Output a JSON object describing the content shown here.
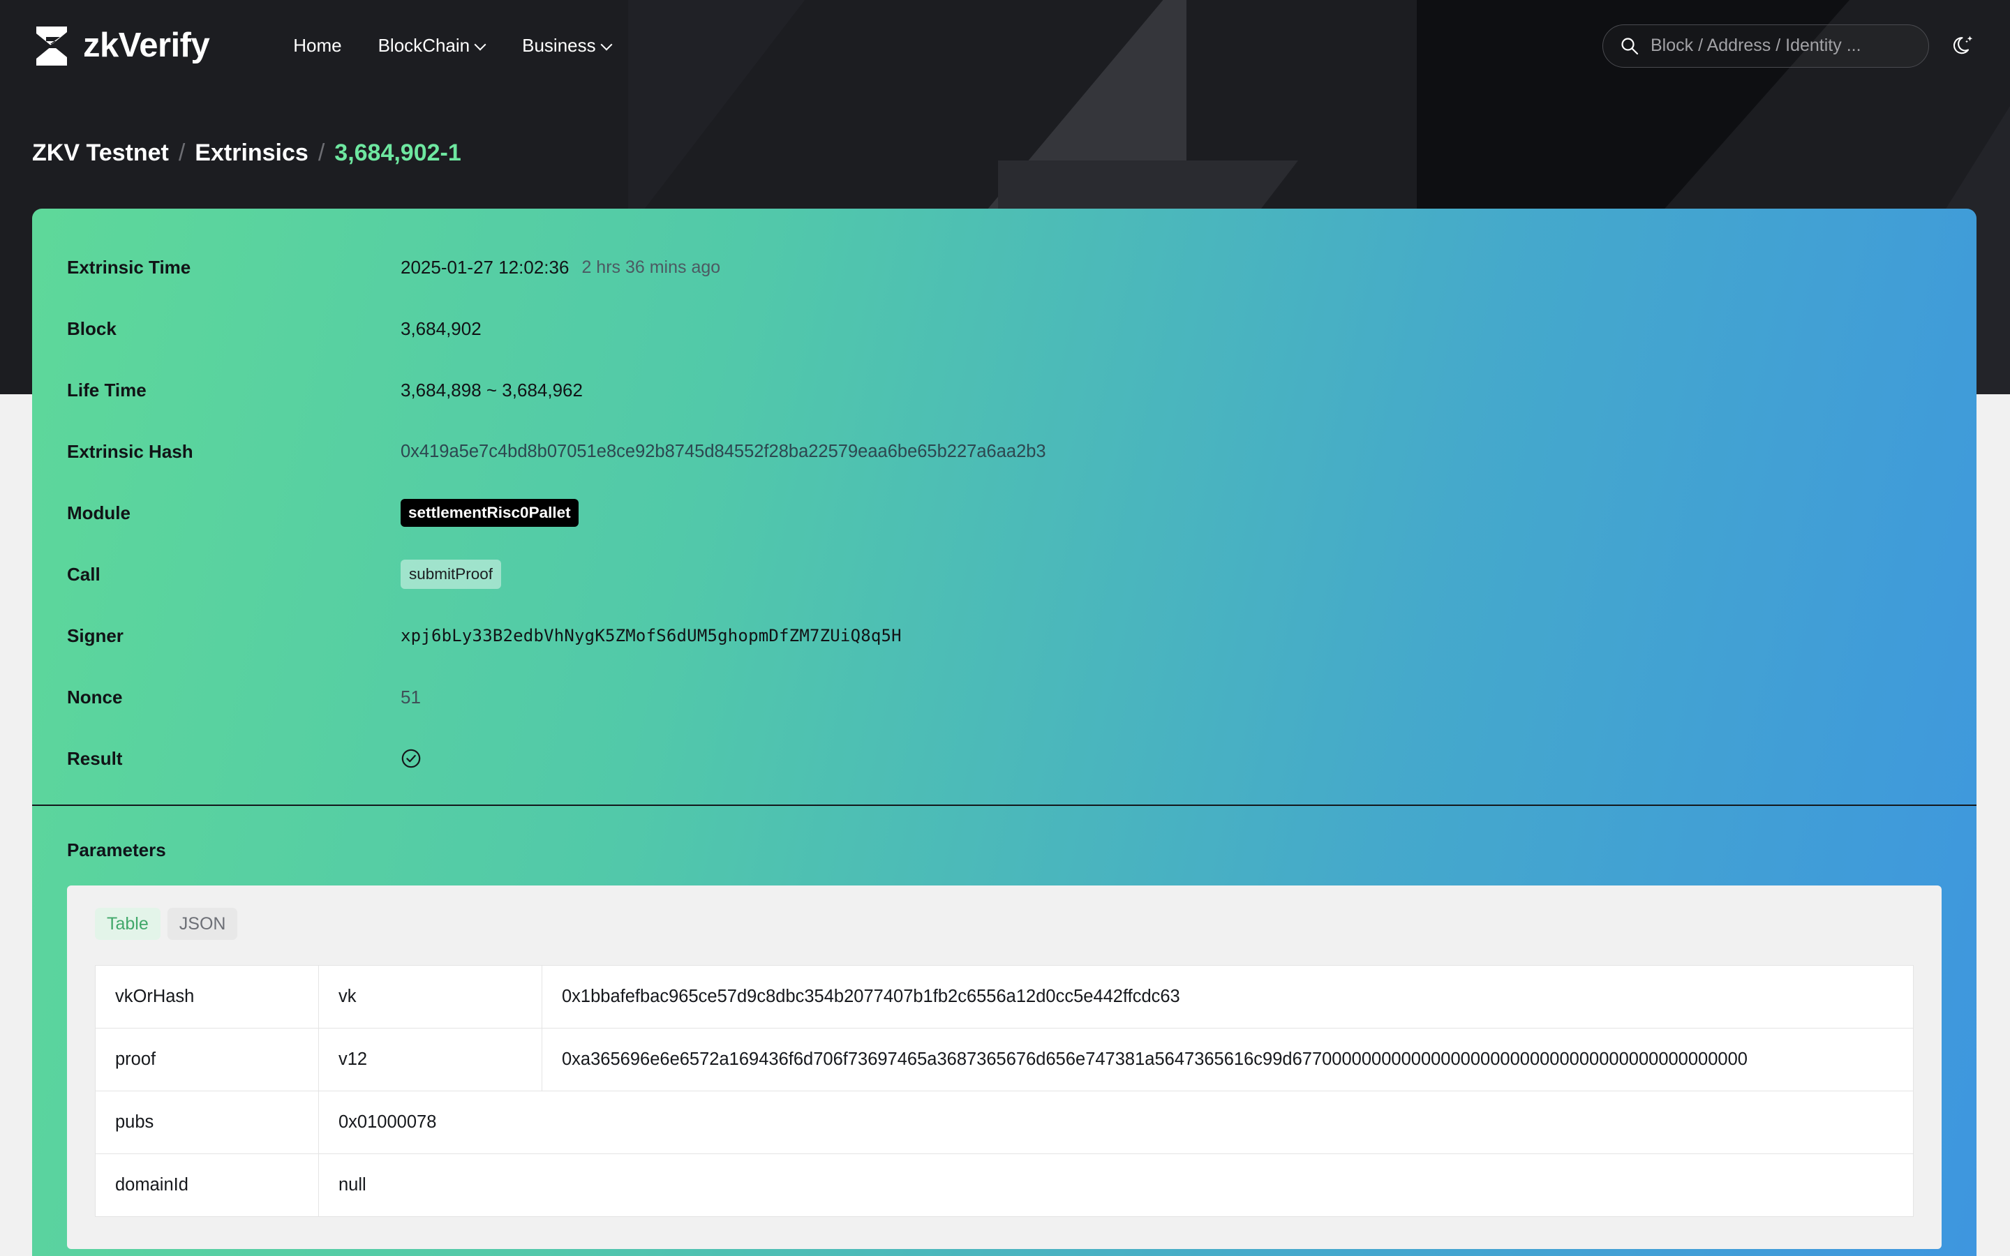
{
  "nav": {
    "brand_name": "zkVerify",
    "logo_icon": "zkverify-hourglass-logo",
    "links": [
      {
        "label": "Home",
        "has_caret": false
      },
      {
        "label": "BlockChain",
        "has_caret": true
      },
      {
        "label": "Business",
        "has_caret": true
      }
    ],
    "search": {
      "placeholder": "Block / Address / Identity ...",
      "value": "",
      "icon": "search-icon"
    },
    "theme_toggle_icon": "moon-sparkle-icon"
  },
  "breadcrumb": {
    "network": "ZKV Testnet",
    "section": "Extrinsics",
    "current": "3,684,902-1",
    "separator": "/"
  },
  "details": [
    {
      "label": "Extrinsic Time",
      "value": "2025-01-27 12:02:36",
      "relative": "2 hrs 36 mins ago",
      "kind": "time"
    },
    {
      "label": "Block",
      "value": "3,684,902",
      "kind": "plain"
    },
    {
      "label": "Life Time",
      "value": "3,684,898 ~ 3,684,962",
      "kind": "plain"
    },
    {
      "label": "Extrinsic Hash",
      "value": "0x419a5e7c4bd8b07051e8ce92b8745d84552f28ba22579eaa6be65b227a6aa2b3",
      "kind": "hash"
    },
    {
      "label": "Module",
      "value": "settlementRisc0Pallet",
      "kind": "badge-dark"
    },
    {
      "label": "Call",
      "value": "submitProof",
      "kind": "badge-light"
    },
    {
      "label": "Signer",
      "value": "xpj6bLy33B2edbVhNygK5ZMofS6dUM5ghopmDfZM7ZUiQ8q5H",
      "kind": "mono"
    },
    {
      "label": "Nonce",
      "value": "51",
      "kind": "nonce"
    },
    {
      "label": "Result",
      "value": "",
      "kind": "icon",
      "icon": "check-circle-icon"
    }
  ],
  "parameters": {
    "title": "Parameters",
    "tabs": [
      {
        "label": "Table",
        "active": true
      },
      {
        "label": "JSON",
        "active": false
      }
    ],
    "rows": [
      {
        "key": "vkOrHash",
        "type": "vk",
        "value": "0x1bbafefbac965ce57d9c8dbc354b2077407b1fb2c6556a12d0cc5e442ffcdc63",
        "span": false
      },
      {
        "key": "proof",
        "type": "v12",
        "value": "0xa365696e6e6572a169436f6d706f73697465a3687365676d656e747381a5647365616c99d6770000000000000000000000000000000000000000000",
        "span": false
      },
      {
        "key": "pubs",
        "type": "0x01000078",
        "value": "",
        "span": true
      },
      {
        "key": "domainId",
        "type": "null",
        "value": "",
        "span": true
      }
    ]
  },
  "colors": {
    "accent_green": "#6ee7a0",
    "card_gradient_start": "#5ed89a",
    "card_gradient_end": "#3e96df",
    "banner_dark": "#1c1d21",
    "tab_active_text": "#41a86a"
  }
}
